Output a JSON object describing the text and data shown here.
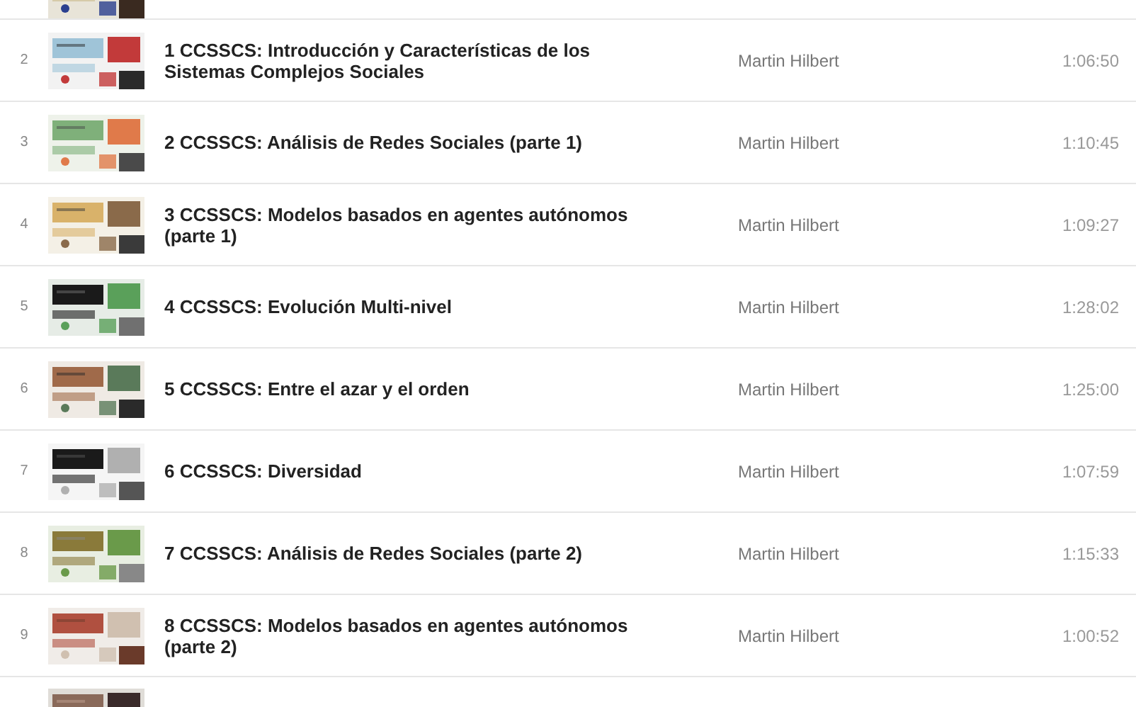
{
  "playlist": {
    "rows": [
      {
        "kind": "cut_top"
      },
      {
        "kind": "video",
        "index": "2",
        "title": "1 CCSSCS: Introducción y Características de los Sistemas Complejos Sociales",
        "author": "Martin Hilbert",
        "duration": "1:06:50"
      },
      {
        "kind": "video",
        "index": "3",
        "title": "2 CCSSCS: Análisis de Redes Sociales (parte 1)",
        "author": "Martin Hilbert",
        "duration": "1:10:45"
      },
      {
        "kind": "video",
        "index": "4",
        "title": "3 CCSSCS: Modelos basados en agentes autónomos (parte 1)",
        "author": "Martin Hilbert",
        "duration": "1:09:27"
      },
      {
        "kind": "video",
        "index": "5",
        "title": "4 CCSSCS: Evolución Multi-nivel",
        "author": "Martin Hilbert",
        "duration": "1:28:02"
      },
      {
        "kind": "video",
        "index": "6",
        "title": "5 CCSSCS: Entre el azar y el orden",
        "author": "Martin Hilbert",
        "duration": "1:25:00"
      },
      {
        "kind": "video",
        "index": "7",
        "title": "6 CCSSCS: Diversidad",
        "author": "Martin Hilbert",
        "duration": "1:07:59"
      },
      {
        "kind": "video",
        "index": "8",
        "title": "7 CCSSCS: Análisis de Redes Sociales (parte 2)",
        "author": "Martin Hilbert",
        "duration": "1:15:33"
      },
      {
        "kind": "video",
        "index": "9",
        "title": "8 CCSSCS: Modelos basados en agentes autónomos (parte 2)",
        "author": "Martin Hilbert",
        "duration": "1:00:52"
      },
      {
        "kind": "cut_bottom"
      }
    ]
  }
}
